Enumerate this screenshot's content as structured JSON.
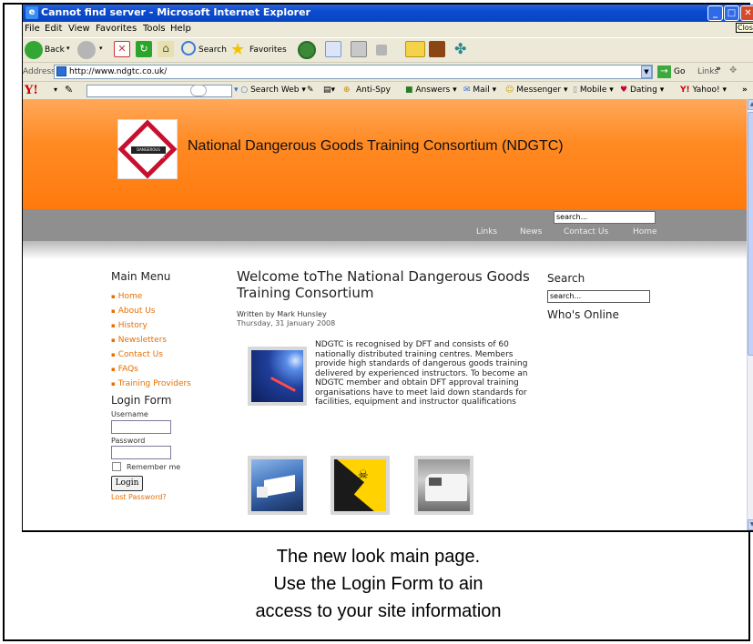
{
  "browser": {
    "title": "Cannot find server - Microsoft Internet Explorer",
    "close_tooltip": "Close",
    "menu": [
      "File",
      "Edit",
      "View",
      "Favorites",
      "Tools",
      "Help"
    ],
    "toolbar": {
      "back_label": "Back",
      "search_label": "Search",
      "favorites_label": "Favorites"
    },
    "address": {
      "label": "Address",
      "url": "http://www.ndgtc.co.uk/",
      "go_label": "Go",
      "links_label": "Links"
    },
    "yahoo": {
      "search_web": "Search Web",
      "anti_spy": "Anti-Spy",
      "answers": "Answers",
      "mail": "Mail",
      "messenger": "Messenger",
      "mobile": "Mobile",
      "dating": "Dating",
      "yahoo_link": "Yahoo!"
    }
  },
  "site": {
    "title": "National Dangerous Goods Training Consortium (NDGTC)",
    "logo_text": "DANGEROUS GOODS TRAINING",
    "search_placeholder": "search...",
    "nav": [
      "Links",
      "News",
      "Contact Us",
      "Home"
    ]
  },
  "left": {
    "main_menu_heading": "Main Menu",
    "menu": [
      "Home",
      "About Us",
      "History",
      "Newsletters",
      "Contact Us",
      "FAQs",
      "Training Providers"
    ],
    "login_heading": "Login Form",
    "username_label": "Username",
    "password_label": "Password",
    "remember_label": "Remember me",
    "login_button": "Login",
    "lost_password": "Lost Password?"
  },
  "article": {
    "title": "Welcome toThe National Dangerous Goods Training Consortium",
    "author": "Written by Mark Hunsley",
    "date": "Thursday, 31 January 2008",
    "body": "NDGTC is recognised by DFT and consists of 60 nationally distributed training centres. Members provide high standards of dangerous goods training delivered by experienced instructors. To become an NDGTC member and obtain DFT approval training organisations have to meet laid down standards for facilities, equipment and instructor qualifications"
  },
  "right": {
    "search_heading": "Search",
    "search_placeholder": "search...",
    "whos_online_heading": "Who's Online"
  },
  "caption": {
    "line1": "The new look main page.",
    "line2": "Use the Login Form to ain",
    "line3": "access to your site information"
  },
  "colors": {
    "header_orange": "#ff8a23",
    "nav_grey": "#8f8f8f",
    "menu_link_orange": "#e86e00",
    "xp_blue": "#0a4bd0"
  },
  "icons": {
    "ie": "ie-icon",
    "back": "back-arrow-icon",
    "forward": "forward-arrow-icon",
    "stop": "stop-icon",
    "refresh": "refresh-icon",
    "home": "home-icon",
    "search": "search-icon",
    "favorites": "star-icon",
    "history": "history-icon"
  }
}
